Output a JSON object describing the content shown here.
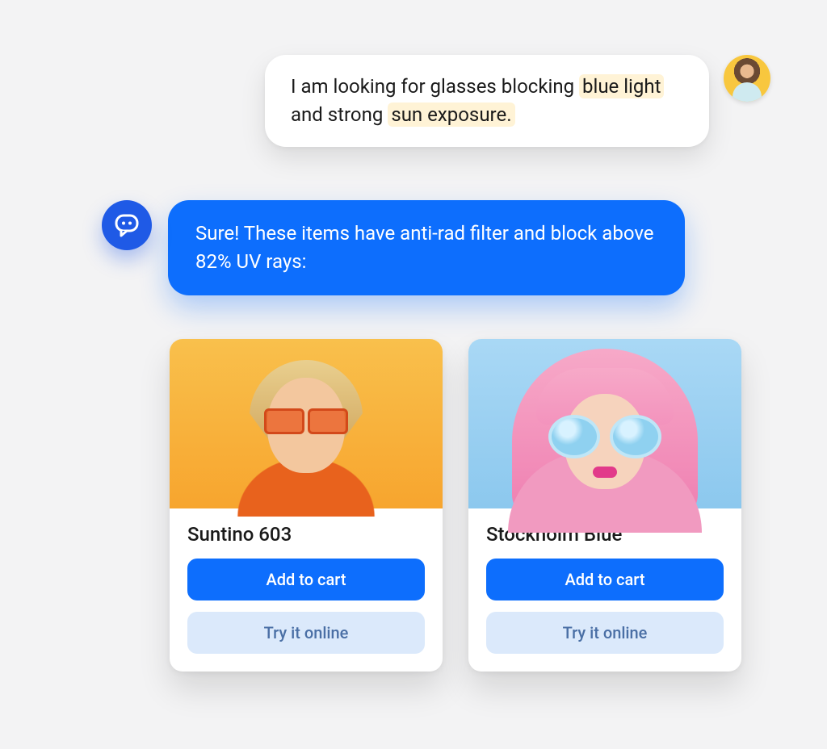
{
  "user_message": {
    "prefix": "I am looking for glasses blocking",
    "highlight1": "blue light",
    "middle": " and strong ",
    "highlight2": "sun exposure."
  },
  "bot_message": "Sure! These items have anti-rad filter and block above 82% UV rays:",
  "products": [
    {
      "title": "Suntino 603",
      "add_label": "Add to cart",
      "try_label": "Try it online"
    },
    {
      "title": "Stockholm Blue",
      "add_label": "Add to cart",
      "try_label": "Try it online"
    }
  ]
}
